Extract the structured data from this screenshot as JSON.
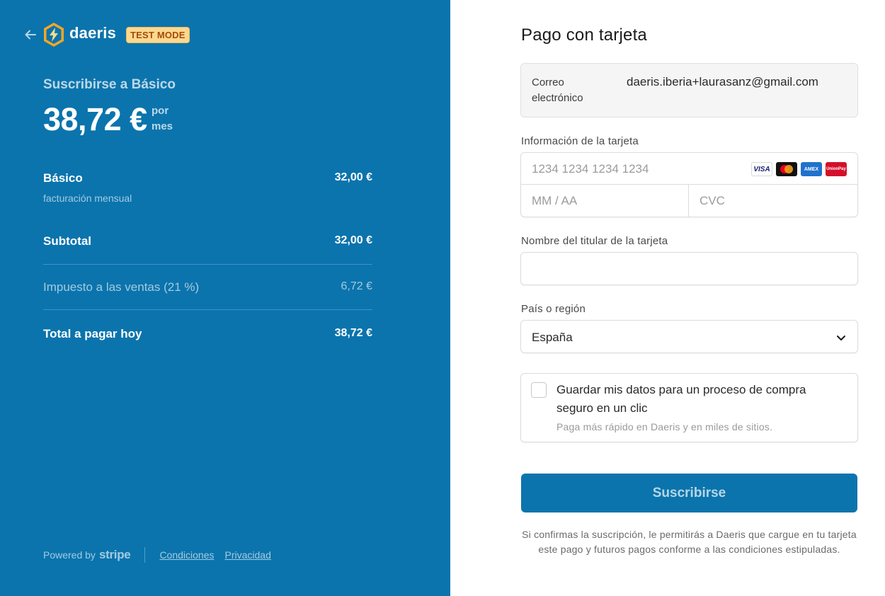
{
  "brand": {
    "name": "daeris",
    "badge": "TEST MODE"
  },
  "summary": {
    "subscribe_title": "Suscribirse a Básico",
    "price": "38,72 €",
    "per_line1": "por",
    "per_line2": "mes",
    "items": [
      {
        "label": "Básico",
        "note": "facturación mensual",
        "value": "32,00 €"
      },
      {
        "label": "Subtotal",
        "value": "32,00 €"
      },
      {
        "label": "Impuesto a las ventas (21 %)",
        "value": "6,72 €"
      },
      {
        "label": "Total a pagar hoy",
        "value": "38,72 €"
      }
    ]
  },
  "footer": {
    "powered_by": "Powered by",
    "stripe": "stripe",
    "terms": "Condiciones",
    "privacy": "Privacidad"
  },
  "payment": {
    "title": "Pago con tarjeta",
    "email_label": "Correo electrónico",
    "email_value": "daeris.iberia+laurasanz@gmail.com",
    "card_label": "Información de la tarjeta",
    "card_number_placeholder": "1234 1234 1234 1234",
    "expiry_placeholder": "MM / AA",
    "cvc_placeholder": "CVC",
    "card_brands": [
      "VISA",
      "mastercard",
      "AMEX",
      "UnionPay"
    ],
    "name_label": "Nombre del titular de la tarjeta",
    "name_value": "",
    "country_label": "País o región",
    "country_value": "España",
    "save_label": "Guardar mis datos para un proceso de compra seguro en un clic",
    "save_sub": "Paga más rápido en Daeris y en miles de sitios.",
    "submit_label": "Suscribirse",
    "legal": "Si confirmas la suscripción, le permitirás a Daeris que cargue en tu tarjeta este pago y futuros pagos conforme a las condiciones estipuladas."
  },
  "colors": {
    "left_bg": "#0b74ad",
    "badge_bg": "#fbd98f",
    "badge_text": "#a84a08",
    "logo_orange": "#f5a623"
  }
}
